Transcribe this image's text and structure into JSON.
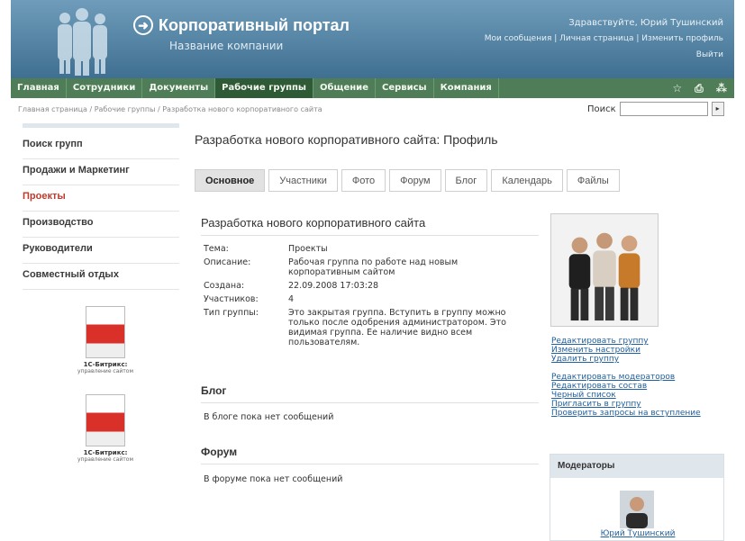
{
  "header": {
    "title": "Корпоративный портал",
    "company": "Название компании",
    "greeting": "Здравствуйте, Юрий Тушинский",
    "links": [
      "Мои сообщения",
      "Личная страница",
      "Изменить профиль"
    ],
    "logout": "Выйти"
  },
  "topnav": {
    "items": [
      "Главная",
      "Сотрудники",
      "Документы",
      "Рабочие группы",
      "Общение",
      "Сервисы",
      "Компания"
    ],
    "active": "Рабочие группы",
    "icons": [
      "star-icon",
      "print-icon",
      "sitemap-icon"
    ]
  },
  "breadcrumb": "Главная страница / Рабочие группы / Разработка нового корпоративного сайта",
  "search": {
    "label": "Поиск",
    "value": ""
  },
  "sidebar": {
    "items": [
      {
        "label": "Поиск групп"
      },
      {
        "label": "Продажи и Маркетинг"
      },
      {
        "label": "Проекты"
      },
      {
        "label": "Производство"
      },
      {
        "label": "Руководители"
      },
      {
        "label": "Совместный отдых"
      }
    ],
    "active": "Проекты",
    "promo": [
      {
        "title": "1С-Битрикс:",
        "subtitle": "управление сайтом"
      },
      {
        "title": "1С-Битрикс:",
        "subtitle": "управление сайтом"
      }
    ]
  },
  "page_title": "Разработка нового корпоративного сайта: Профиль",
  "tabs": [
    "Основное",
    "Участники",
    "Фото",
    "Форум",
    "Блог",
    "Календарь",
    "Файлы"
  ],
  "active_tab": "Основное",
  "group": {
    "name": "Разработка нового корпоративного сайта",
    "fields": [
      {
        "key": "Тема:",
        "value": "Проекты"
      },
      {
        "key": "Описание:",
        "value": "Рабочая группа по работе над новым корпоративным сайтом"
      },
      {
        "key": "Создана:",
        "value": "22.09.2008 17:03:28"
      },
      {
        "key": "Участников:",
        "value": "4"
      },
      {
        "key": "Тип группы:",
        "value": "Это закрытая группа. Вступить в группу можно только после одобрения администратором. Это видимая группа. Ее наличие видно всем пользователям."
      }
    ]
  },
  "blog": {
    "title": "Блог",
    "message": "В блоге пока нет сообщений"
  },
  "forum": {
    "title": "Форум",
    "message": "В форуме пока нет сообщений"
  },
  "actions_group1": [
    "Редактировать группу",
    "Изменить настройки",
    "Удалить группу"
  ],
  "actions_group2": [
    "Редактировать модераторов",
    "Редактировать состав",
    "Черный список",
    "Пригласить в группу",
    "Проверить запросы на вступление"
  ],
  "moderators": {
    "title": "Модераторы",
    "name": "Юрий Тушинский"
  }
}
